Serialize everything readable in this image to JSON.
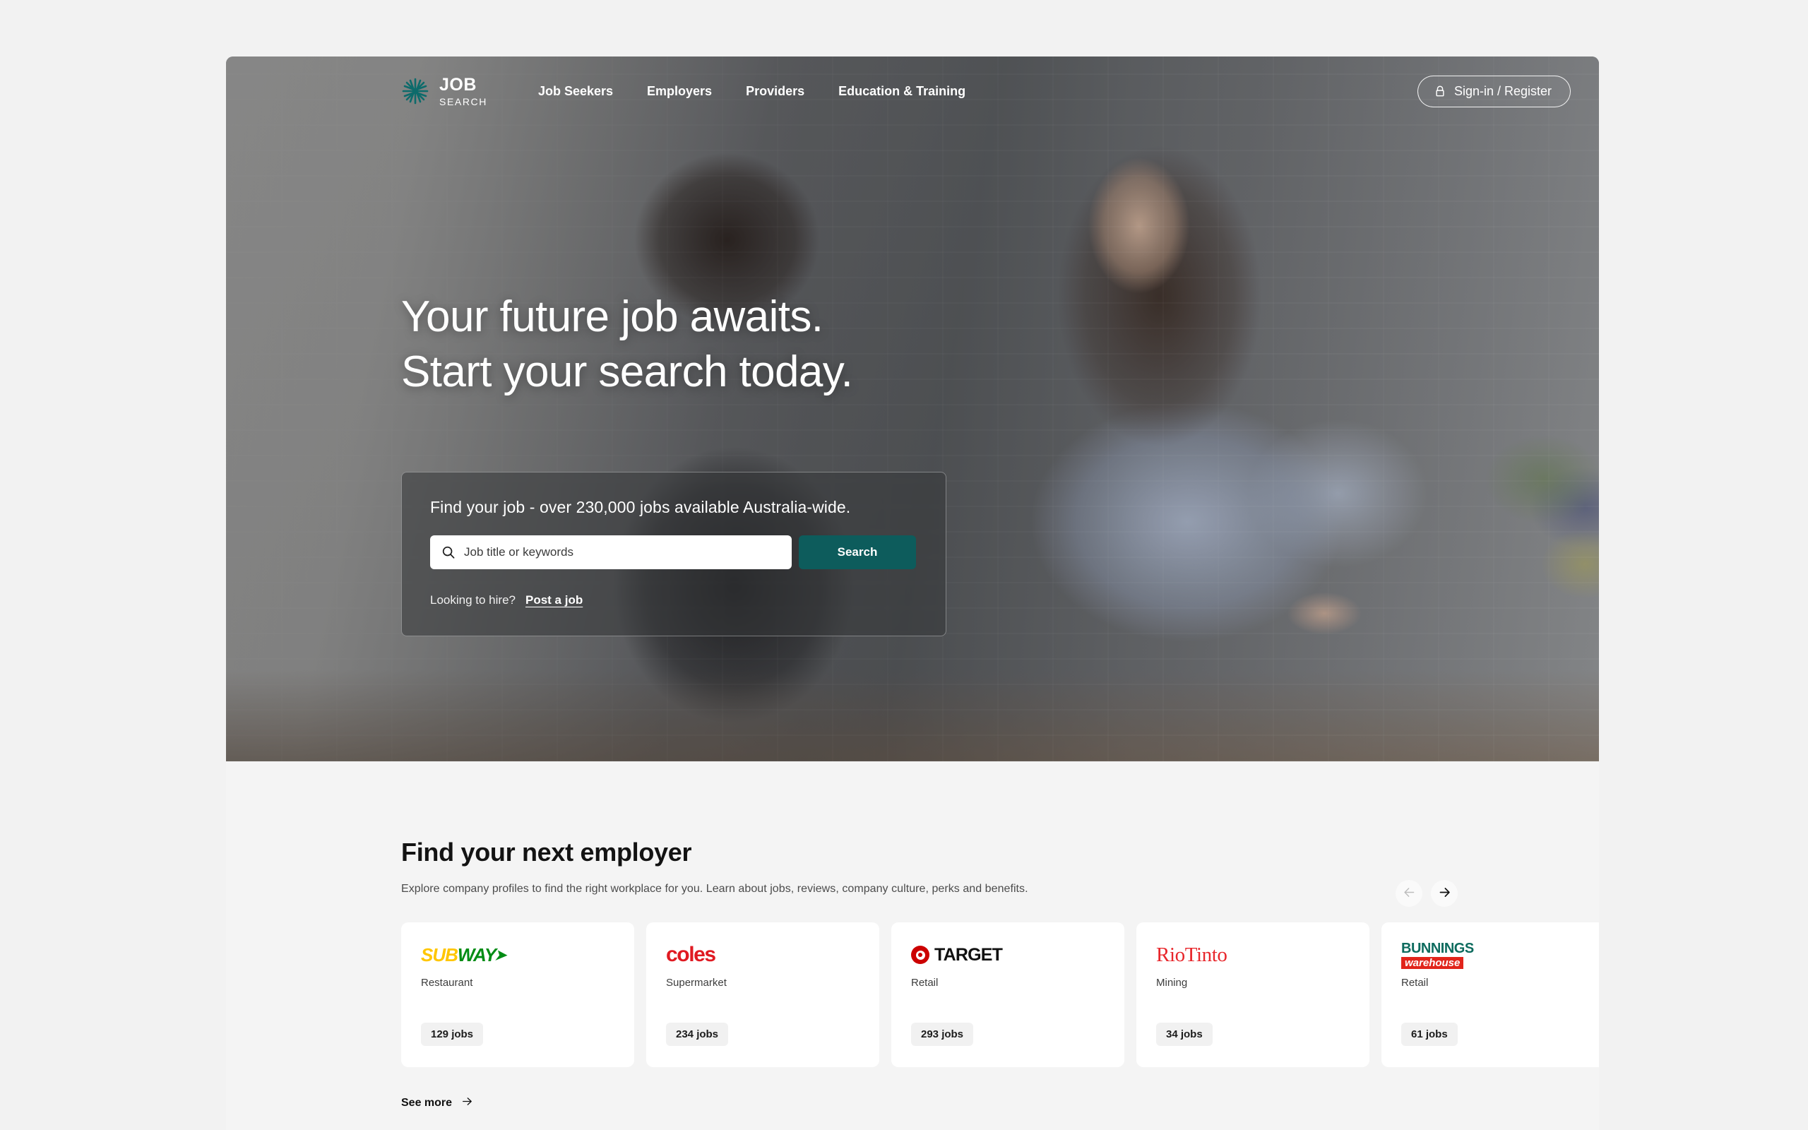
{
  "brand": {
    "line1": "JOB",
    "line2": "SEARCH",
    "mark_icon": "starburst-icon",
    "accent_color": "#0d6b6b"
  },
  "header": {
    "nav": [
      {
        "label": "Job Seekers"
      },
      {
        "label": "Employers"
      },
      {
        "label": "Providers"
      },
      {
        "label": "Education & Training"
      }
    ],
    "signin": {
      "label": "Sign-in / Register",
      "icon": "lock-icon"
    }
  },
  "hero": {
    "title_line1": "Your future job awaits.",
    "title_line2": "Start your search today."
  },
  "search": {
    "heading": "Find your job - over 230,000 jobs available Australia-wide.",
    "placeholder": "Job title or keywords",
    "value": "",
    "search_icon": "search-icon",
    "submit_label": "Search",
    "submit_color": "#0d5c5c",
    "hire_label": "Looking to hire?",
    "hire_link": "Post a job"
  },
  "employers": {
    "title": "Find your next employer",
    "subtitle": "Explore company profiles to find the right workplace for you. Learn about jobs, reviews, company culture, perks and benefits.",
    "prev_icon": "arrow-left-icon",
    "next_icon": "arrow-right-icon",
    "prev_enabled": false,
    "next_enabled": true,
    "see_more_label": "See more",
    "see_more_icon": "arrow-right-icon",
    "cards": [
      {
        "name": "SUBWAY",
        "industry": "Restaurant",
        "jobs": "129 jobs"
      },
      {
        "name": "coles",
        "industry": "Supermarket",
        "jobs": "234 jobs"
      },
      {
        "name": "TARGET",
        "industry": "Retail",
        "jobs": "293 jobs"
      },
      {
        "name": "RioTinto",
        "industry": "Mining",
        "jobs": "34 jobs"
      },
      {
        "name": "Bunnings Warehouse",
        "industry": "Retail",
        "jobs": "61 jobs"
      }
    ]
  }
}
